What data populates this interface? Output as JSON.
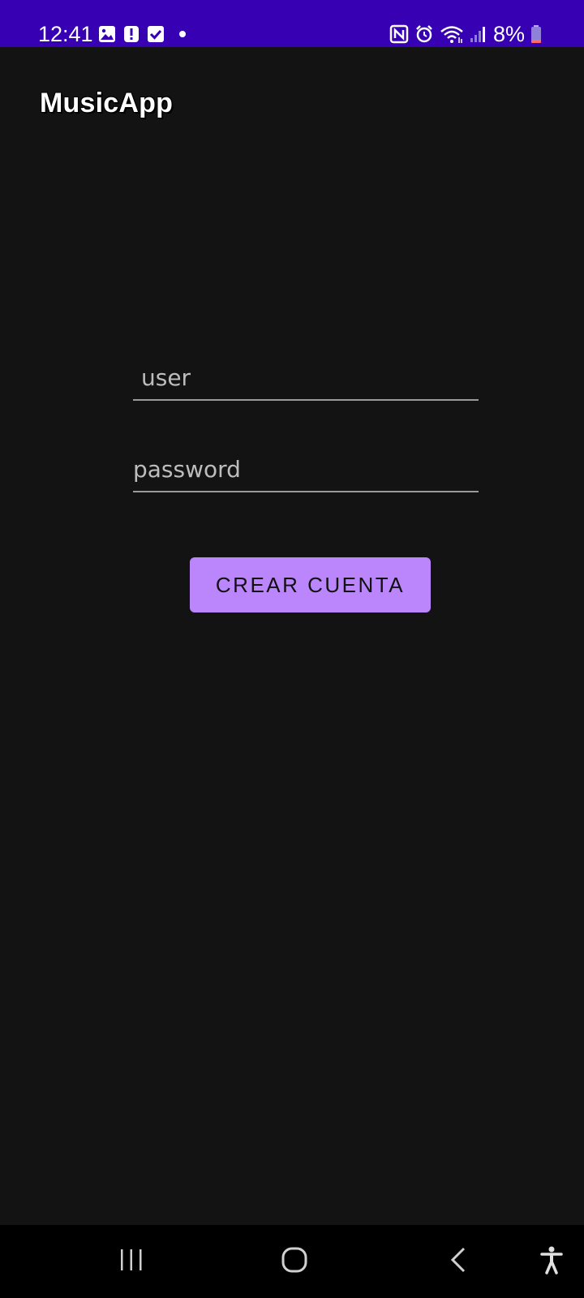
{
  "status_bar": {
    "time": "12:41",
    "battery_percent": "8%",
    "background_color": "#3700b3",
    "left_icons": [
      "image-icon",
      "alert-icon",
      "check-box-icon",
      "dot-icon"
    ],
    "right_icons": [
      "nfc-icon",
      "alarm-icon",
      "wifi-icon",
      "signal-icon",
      "battery-icon"
    ]
  },
  "app": {
    "title": "MusicApp"
  },
  "form": {
    "user_placeholder": "user",
    "password_placeholder": "password",
    "create_account_label": "CREAR CUENTA",
    "accent_color": "#bb86fc"
  },
  "nav_bar": {
    "buttons": [
      "recent-apps-icon",
      "home-icon",
      "back-icon",
      "accessibility-icon"
    ]
  }
}
